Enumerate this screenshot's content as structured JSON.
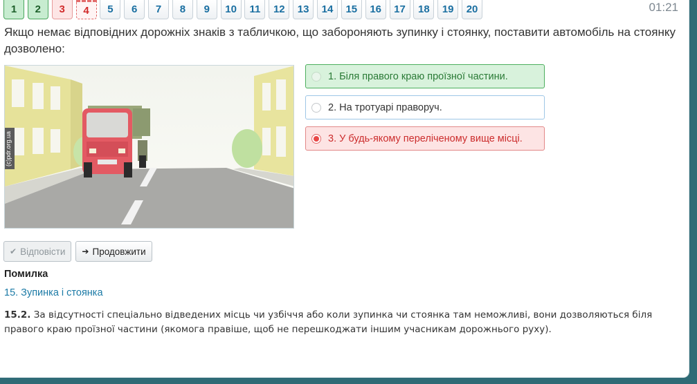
{
  "nav": {
    "questions": [
      {
        "label": "1",
        "state": "ok"
      },
      {
        "label": "2",
        "state": "ok"
      },
      {
        "label": "3",
        "state": "err"
      },
      {
        "label": "4",
        "state": "current"
      },
      {
        "label": "5",
        "state": "none"
      },
      {
        "label": "6",
        "state": "none"
      },
      {
        "label": "7",
        "state": "none"
      },
      {
        "label": "8",
        "state": "none"
      },
      {
        "label": "9",
        "state": "none"
      },
      {
        "label": "10",
        "state": "none"
      },
      {
        "label": "11",
        "state": "none"
      },
      {
        "label": "12",
        "state": "none"
      },
      {
        "label": "13",
        "state": "none"
      },
      {
        "label": "14",
        "state": "none"
      },
      {
        "label": "15",
        "state": "none"
      },
      {
        "label": "16",
        "state": "none"
      },
      {
        "label": "17",
        "state": "none"
      },
      {
        "label": "18",
        "state": "none"
      },
      {
        "label": "19",
        "state": "none"
      },
      {
        "label": "20",
        "state": "none"
      }
    ],
    "timer": "01:21"
  },
  "question": {
    "text": "Якщо немає відповідних дорожніх знаків з табличкою, що забороняють зупинку і стоянку, поставити автомобіль на стоянку дозволено:",
    "image_caption": "(с)pdr.org.ua"
  },
  "answers": [
    {
      "label": "1. Біля правого краю проїзної частини.",
      "state": "correct"
    },
    {
      "label": "2. На тротуарі праворуч.",
      "state": "neutral"
    },
    {
      "label": "3. У будь-якому переліченому вище місці.",
      "state": "wrong"
    }
  ],
  "buttons": {
    "answer_label": "Відповісти",
    "continue_label": "Продовжити"
  },
  "result": {
    "title": "Помилка",
    "topic": "15. Зупинка і стоянка",
    "rule_number": "15.2.",
    "rule_text": " За відсутності спеціально відведених місць чи узбіччя або коли зупинка чи стоянка там неможливі, вони дозволяються біля правого краю проїзної частини (якомога правіше, щоб не перешкоджати іншим учасникам дорожнього руху)."
  },
  "colors": {
    "correct": "#d8f2dc",
    "wrong": "#fde4e4",
    "link": "#1b7aa6",
    "frame": "#2f6b76"
  }
}
